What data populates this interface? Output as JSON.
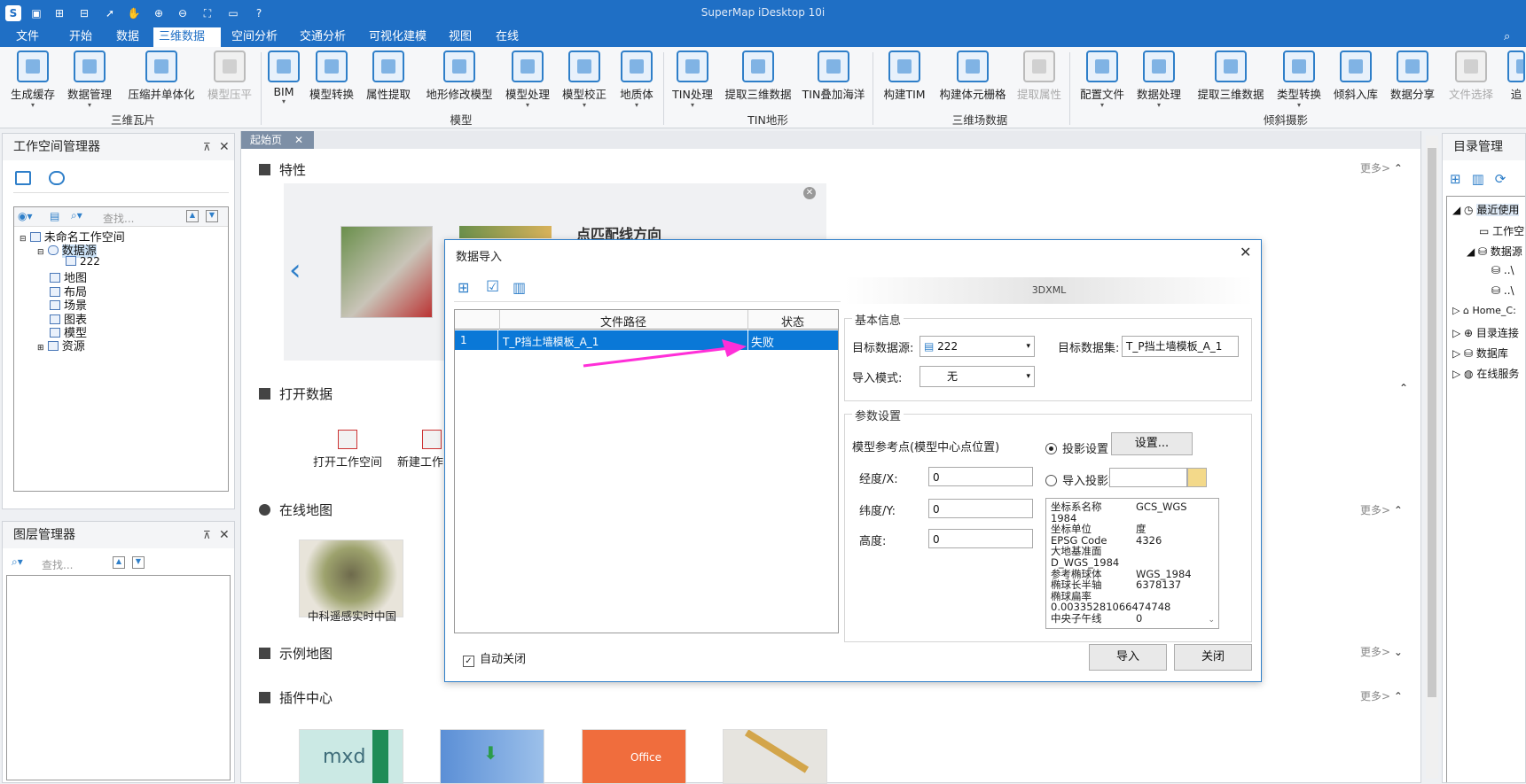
{
  "app": {
    "title": "SuperMap iDesktop 10i"
  },
  "menu": [
    "文件",
    "开始",
    "数据",
    "三维数据",
    "空间分析",
    "交通分析",
    "可视化建模",
    "视图",
    "在线"
  ],
  "ribbon": {
    "groups": {
      "g1": "三维瓦片",
      "g2": "模型",
      "g3": "TIN地形",
      "g4": "三维场数据",
      "g5": "倾斜摄影"
    },
    "buttons": {
      "b1": "生成缓存",
      "b2": "数据管理",
      "b3": "压缩并单体化",
      "b4": "模型压平",
      "b5": "BIM",
      "b6": "模型转换",
      "b7": "属性提取",
      "b8": "地形修改模型",
      "b9": "模型处理",
      "b10": "模型校正",
      "b11": "地质体",
      "b12": "TIN处理",
      "b13": "提取三维数据",
      "b14": "TIN叠加海洋",
      "b15": "构建TIM",
      "b16": "构建体元栅格",
      "b17": "提取属性",
      "b18": "配置文件",
      "b19": "数据处理",
      "b20": "提取三维数据",
      "b21": "类型转换",
      "b22": "倾斜入库",
      "b23": "数据分享",
      "b24": "文件选择",
      "b25": "追"
    }
  },
  "workspace": {
    "title": "工作空间管理器",
    "search_placeholder": "查找...",
    "tree": {
      "root": "未命名工作空间",
      "datasource": "数据源",
      "ds1": "222",
      "map": "地图",
      "layout": "布局",
      "scene": "场景",
      "chart": "图表",
      "model": "模型",
      "resource": "资源"
    }
  },
  "layers": {
    "title": "图层管理器",
    "search_placeholder": "查找..."
  },
  "catalog": {
    "title": "目录管理",
    "items": {
      "recent": "最近使用",
      "ws": "工作空",
      "ds": "数据源",
      "p1": "..\\",
      "p2": "..\\",
      "home": "Home_C:",
      "link": "目录连接",
      "db": "数据库",
      "online": "在线服务"
    }
  },
  "start": {
    "tab": "起始页",
    "feature": {
      "title": "特性",
      "more": "更多>",
      "banner": "点匹配线方向"
    },
    "open": {
      "title": "打开数据",
      "btn1": "打开工作空间",
      "btn2": "新建工作"
    },
    "online_map": {
      "title": "在线地图",
      "more": "更多>",
      "item": "中科遥感实时中国"
    },
    "sample": {
      "title": "示例地图",
      "more": "更多>"
    },
    "plugin": {
      "title": "插件中心",
      "more": "更多>",
      "tile1": "mxd",
      "tile3": "Office"
    }
  },
  "dialog": {
    "title": "数据导入",
    "format_header": "3DXML",
    "table": {
      "headers": [
        "文件路径",
        "状态"
      ],
      "row": {
        "no": "1",
        "path": "T_P挡土墙模板_A_1",
        "status": "失败"
      }
    },
    "basic": {
      "legend": "基本信息",
      "target_ds_label": "目标数据源:",
      "target_ds_value": "222",
      "target_dataset_label": "目标数据集:",
      "target_dataset_value": "T_P挡土墙模板_A_1",
      "mode_label": "导入模式:",
      "mode_value": "无"
    },
    "params": {
      "legend": "参数设置",
      "ref_label": "模型参考点(模型中心点位置)",
      "proj_setting": "投影设置",
      "settings_btn": "设置...",
      "import_proj": "导入投影文",
      "lon_label": "经度/X:",
      "lon_value": "0",
      "lat_label": "纬度/Y:",
      "lat_value": "0",
      "height_label": "高度:",
      "height_value": "0",
      "crs": [
        [
          "坐标系名称",
          "GCS_WGS"
        ],
        [
          "1984",
          ""
        ],
        [
          "坐标单位",
          "度"
        ],
        [
          "EPSG Code",
          "4326"
        ],
        [
          "大地基准面",
          "D_WGS_1984"
        ],
        [
          "参考椭球体",
          "WGS_1984"
        ],
        [
          "椭球长半轴",
          "6378137"
        ],
        [
          "椭球扁率",
          ""
        ],
        [
          "0.00335281066474748",
          ""
        ],
        [
          "中央子午线",
          "0"
        ]
      ]
    },
    "auto_close": "自动关闭",
    "import_btn": "导入",
    "close_btn": "关闭"
  },
  "colors": {
    "accent": "#1f6fc5",
    "selection": "#0a78d7",
    "arrow": "#ff2fd8"
  }
}
